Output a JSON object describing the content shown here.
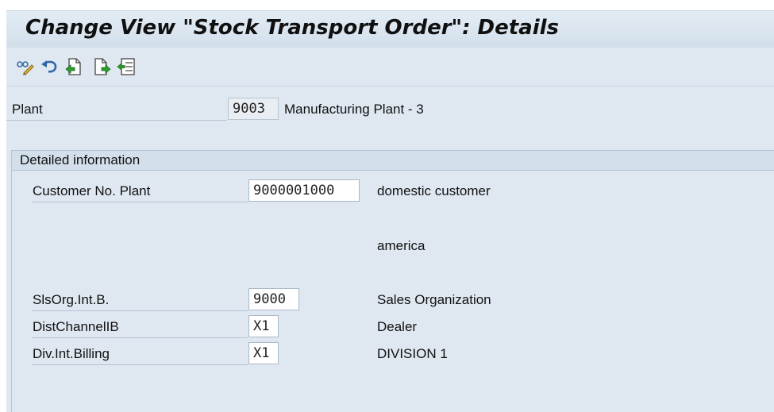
{
  "window": {
    "title": "Change View \"Stock Transport Order\": Details"
  },
  "toolbar": {
    "buttons": [
      {
        "icon": "display-change-icon"
      },
      {
        "icon": "undo-icon"
      },
      {
        "icon": "previous-entry-icon"
      },
      {
        "icon": "next-entry-icon"
      },
      {
        "icon": "select-all-icon"
      }
    ]
  },
  "header": {
    "plant_label": "Plant",
    "plant_value": "9003",
    "plant_desc": "Manufacturing Plant - 3"
  },
  "detail": {
    "group_title": "Detailed information",
    "customer_label": "Customer No. Plant",
    "customer_value": "9000001000",
    "customer_desc1": "domestic customer",
    "customer_desc2": "america",
    "salesorg_label": "SlsOrg.Int.B.",
    "salesorg_value": "9000",
    "salesorg_desc": "Sales Organization",
    "distchannel_label": "DistChannelIB",
    "distchannel_value": "X1",
    "distchannel_desc": "Dealer",
    "division_label": "Div.Int.Billing",
    "division_value": "X1",
    "division_desc": "DIVISION 1"
  },
  "colors": {
    "background": "#dfe8f1",
    "title_bar": "#d2dfeb",
    "group_header": "#d3dfea"
  }
}
